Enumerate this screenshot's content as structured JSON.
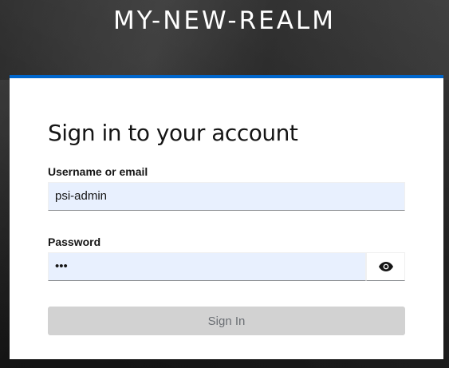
{
  "header": {
    "realm_title": "MY-NEW-REALM"
  },
  "login_form": {
    "title": "Sign in to your account",
    "username": {
      "label": "Username or email",
      "value": "psi-admin",
      "placeholder": ""
    },
    "password": {
      "label": "Password",
      "value": "•••",
      "toggle_icon": "eye-icon"
    },
    "submit_label": "Sign In"
  },
  "colors": {
    "accent": "#0066cc",
    "background": "#2b2b2b",
    "input_autofill": "#e8f0fe",
    "button_disabled": "#d2d2d2"
  }
}
